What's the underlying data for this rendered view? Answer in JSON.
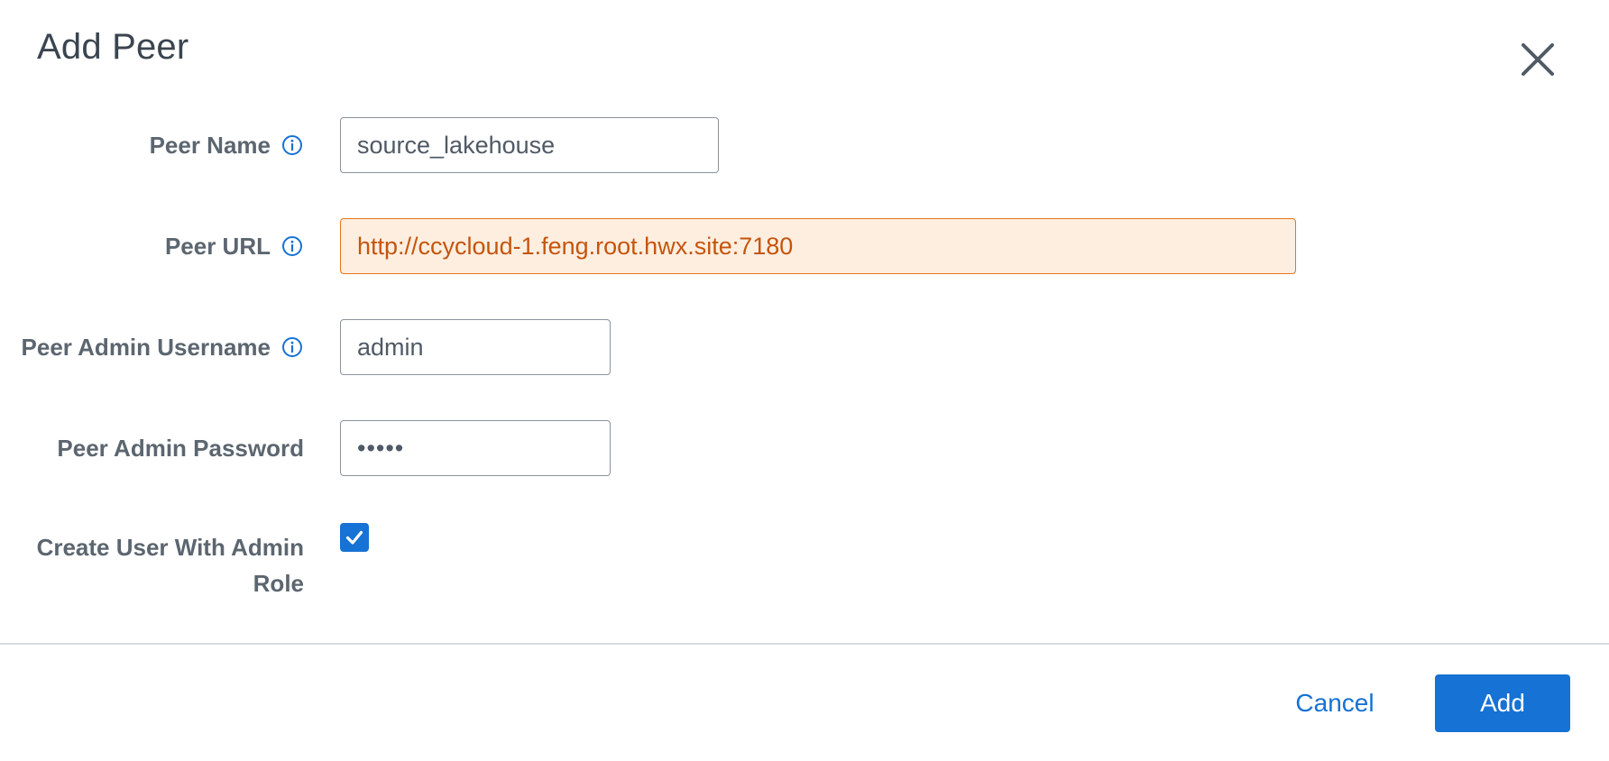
{
  "dialog": {
    "title": "Add Peer",
    "close_icon": "close-icon"
  },
  "form": {
    "peer_name": {
      "label": "Peer Name",
      "has_info": true,
      "value": "source_lakehouse"
    },
    "peer_url": {
      "label": "Peer URL",
      "has_info": true,
      "value": "http://ccycloud-1.feng.root.hwx.site:7180",
      "state": "warning"
    },
    "peer_admin_username": {
      "label": "Peer Admin Username",
      "has_info": true,
      "value": "admin"
    },
    "peer_admin_password": {
      "label": "Peer Admin Password",
      "has_info": false,
      "value": "•••••"
    },
    "create_user_with_admin_role": {
      "label": "Create User With Admin Role",
      "checked": true
    }
  },
  "footer": {
    "cancel_label": "Cancel",
    "add_label": "Add"
  },
  "colors": {
    "accent": "#1672d4",
    "warning_border": "#e8741a",
    "warning_bg": "#fdeee0",
    "warning_text": "#c5550c",
    "label_text": "#5c6670"
  },
  "icons": [
    "close-icon",
    "info-icon",
    "checkmark-icon"
  ]
}
